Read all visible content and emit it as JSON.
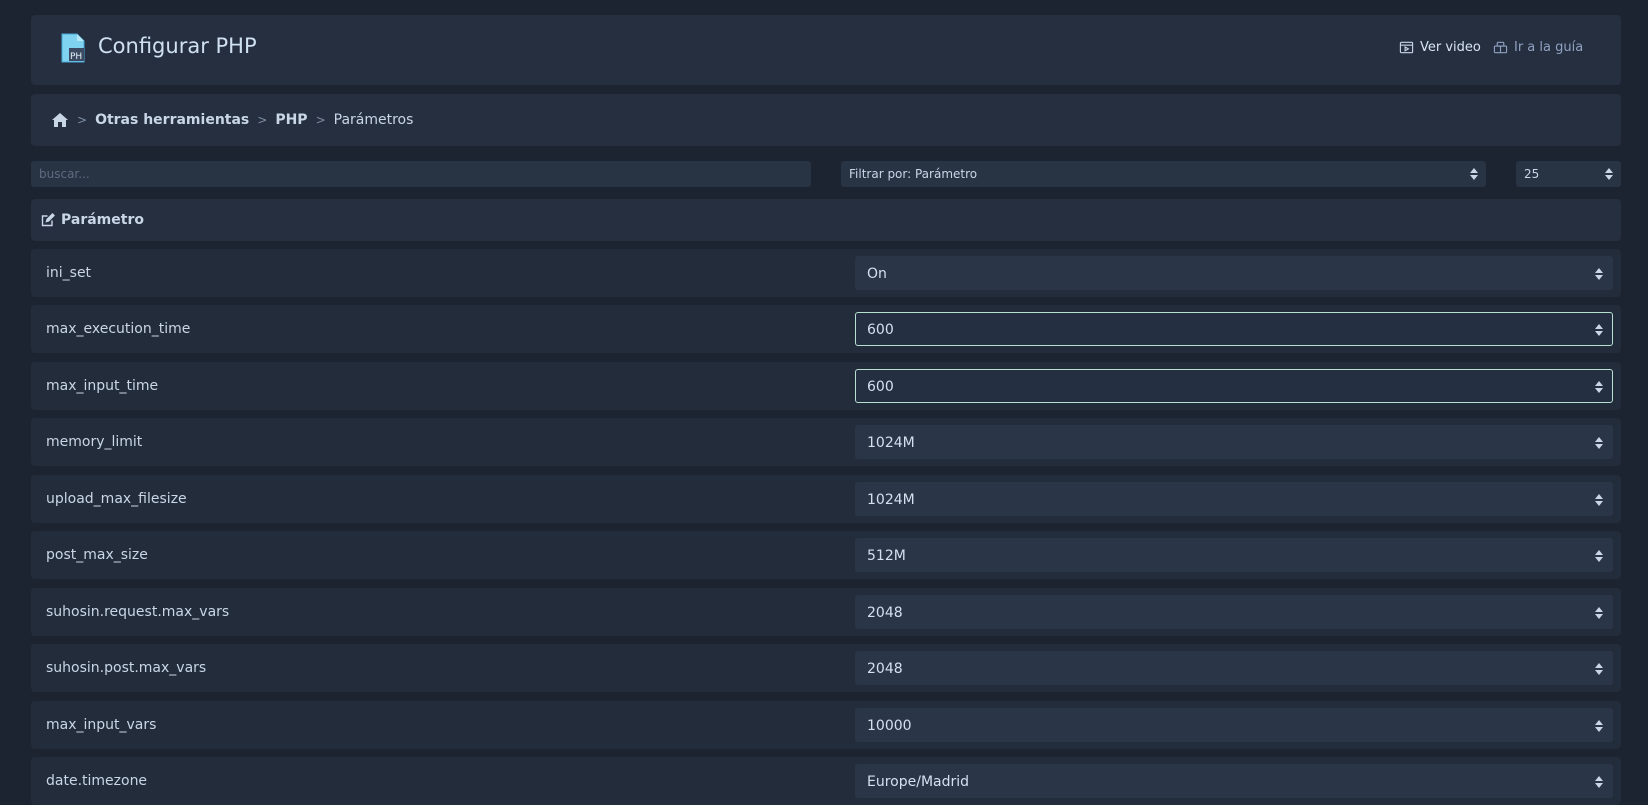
{
  "header": {
    "title": "Configurar PHP",
    "video_label": "Ver video",
    "guide_label": "Ir a la guía"
  },
  "breadcrumb": {
    "items": [
      "Otras herramientas",
      "PHP",
      "Parámetros"
    ],
    "separator": ">"
  },
  "toolbar": {
    "search_placeholder": "buscar...",
    "filter_value": "Filtrar por: Parámetro",
    "per_page_value": "25"
  },
  "section": {
    "title": "Parámetro"
  },
  "params": [
    {
      "name": "ini_set",
      "value": "On"
    },
    {
      "name": "max_execution_time",
      "value": "600"
    },
    {
      "name": "max_input_time",
      "value": "600"
    },
    {
      "name": "memory_limit",
      "value": "1024M"
    },
    {
      "name": "upload_max_filesize",
      "value": "1024M"
    },
    {
      "name": "post_max_size",
      "value": "512M"
    },
    {
      "name": "suhosin.request.max_vars",
      "value": "2048"
    },
    {
      "name": "suhosin.post.max_vars",
      "value": "2048"
    },
    {
      "name": "max_input_vars",
      "value": "10000"
    },
    {
      "name": "date.timezone",
      "value": "Europe/Madrid"
    }
  ],
  "colors": {
    "background": "#1c2431",
    "panel": "#252f40",
    "focus_border": "#b8e0d0",
    "guide_link": "#8fa0c0"
  },
  "icons": {
    "logo": "php-file-icon",
    "video": "video-icon",
    "guide": "guide-icon",
    "home": "home-icon",
    "section": "edit-icon",
    "select": "sort-arrows-icon"
  }
}
